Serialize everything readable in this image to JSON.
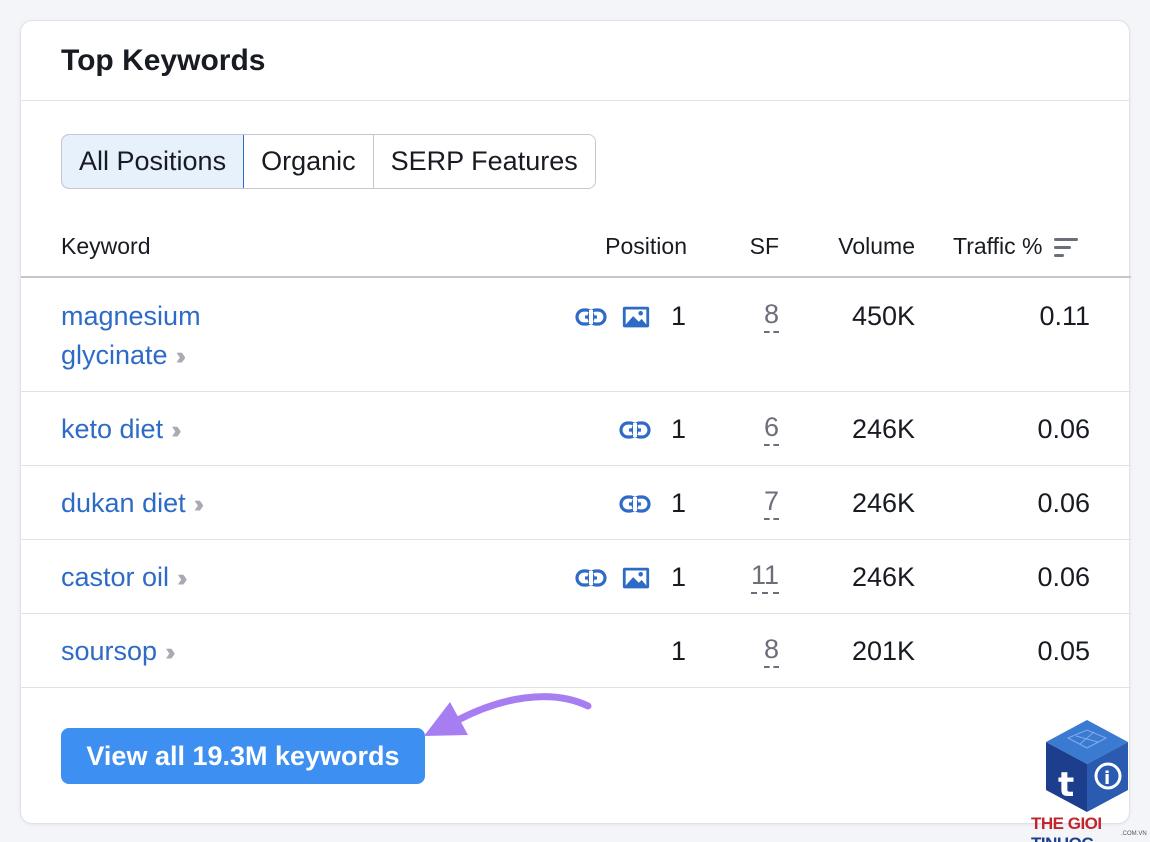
{
  "card": {
    "title": "Top Keywords"
  },
  "tabs": [
    {
      "label": "All Positions",
      "active": true
    },
    {
      "label": "Organic",
      "active": false
    },
    {
      "label": "SERP Features",
      "active": false
    }
  ],
  "columns": {
    "keyword": "Keyword",
    "position": "Position",
    "sf": "SF",
    "volume": "Volume",
    "traffic": "Traffic %"
  },
  "rows": [
    {
      "keyword_line1": "magnesium",
      "keyword_line2": "glycinate",
      "features": [
        "link-icon",
        "image-icon"
      ],
      "position": "1",
      "sf": "8",
      "volume": "450K",
      "traffic": "0.11"
    },
    {
      "keyword_line1": "keto diet",
      "keyword_line2": "",
      "features": [
        "link-icon"
      ],
      "position": "1",
      "sf": "6",
      "volume": "246K",
      "traffic": "0.06"
    },
    {
      "keyword_line1": "dukan diet",
      "keyword_line2": "",
      "features": [
        "link-icon"
      ],
      "position": "1",
      "sf": "7",
      "volume": "246K",
      "traffic": "0.06"
    },
    {
      "keyword_line1": "castor oil",
      "keyword_line2": "",
      "features": [
        "link-icon",
        "image-icon"
      ],
      "position": "1",
      "sf": "11",
      "volume": "246K",
      "traffic": "0.06"
    },
    {
      "keyword_line1": "soursop",
      "keyword_line2": "",
      "features": [],
      "position": "1",
      "sf": "8",
      "volume": "201K",
      "traffic": "0.05"
    }
  ],
  "view_all_label": "View all 19.3M keywords",
  "watermark": {
    "part1": "THE GIOI",
    "part2": "TINHOC",
    "sub": ".COM.VN"
  },
  "colors": {
    "link": "#2e6bc6",
    "button": "#3e8ff2",
    "arrow": "#a77ef2",
    "active_tab_bg": "#e7f1fc"
  }
}
